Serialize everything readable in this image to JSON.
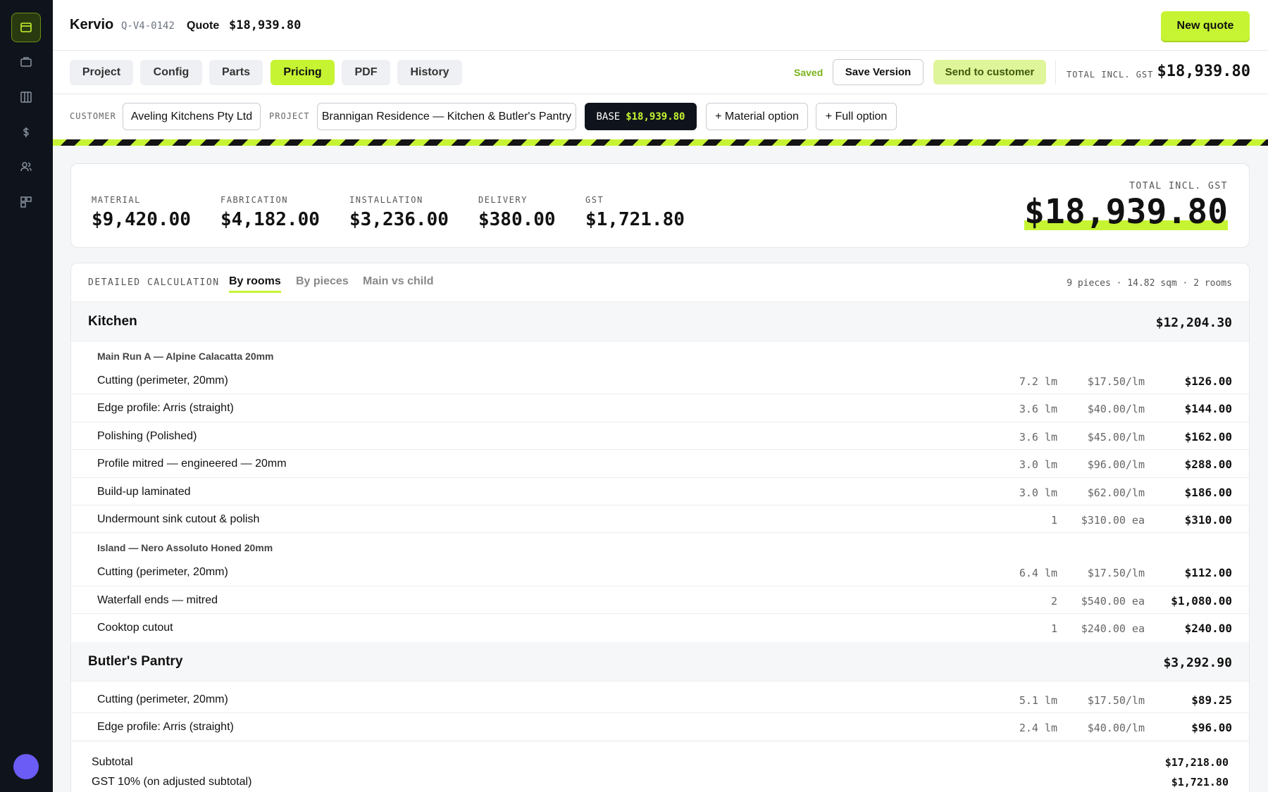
{
  "app": {
    "brand": "Kervio",
    "quote_id": "Q-V4-0142",
    "quote_label": "Quote",
    "quote_amount": "$18,939.80",
    "new_quote": "New quote"
  },
  "tabs": [
    "Project",
    "Config",
    "Parts",
    "Pricing",
    "PDF",
    "History"
  ],
  "active_tab": "Pricing",
  "status": {
    "saved": "Saved",
    "save_version": "Save Version",
    "send_to_customer": "Send to customer",
    "total_label": "TOTAL INCL. GST",
    "total_value": "$18,939.80"
  },
  "filters": {
    "customer_label": "CUSTOMER",
    "customer": "Aveling Kitchens Pty Ltd",
    "project_label": "PROJECT",
    "project": "Brannigan Residence — Kitchen & Butler's Pantry",
    "base_label": "BASE",
    "base_amount": "$18,939.80",
    "material_option": "+ Material option",
    "full_option": "+ Full option"
  },
  "summary": {
    "metrics": [
      {
        "label": "MATERIAL",
        "value": "$9,420.00"
      },
      {
        "label": "FABRICATION",
        "value": "$4,182.00"
      },
      {
        "label": "INSTALLATION",
        "value": "$3,236.00"
      },
      {
        "label": "DELIVERY",
        "value": "$380.00"
      },
      {
        "label": "GST",
        "value": "$1,721.80"
      }
    ],
    "total_label": "TOTAL INCL. GST",
    "total_value": "$18,939.80"
  },
  "detail": {
    "label": "DETAILED CALCULATION",
    "views": [
      "By rooms",
      "By pieces",
      "Main vs child"
    ],
    "active_view": "By rooms",
    "stats": "9 pieces · 14.82 sqm · 2 rooms",
    "rooms": [
      {
        "name": "Kitchen",
        "total": "$12,204.30",
        "groups": [
          {
            "name": "Main Run A — Alpine Calacatta 20mm",
            "items": [
              {
                "name": "Cutting (perimeter, 20mm)",
                "qty": "7.2 lm",
                "rate": "$17.50/lm",
                "amount": "$126.00"
              },
              {
                "name": "Edge profile: Arris (straight)",
                "qty": "3.6 lm",
                "rate": "$40.00/lm",
                "amount": "$144.00"
              },
              {
                "name": "Polishing (Polished)",
                "qty": "3.6 lm",
                "rate": "$45.00/lm",
                "amount": "$162.00"
              },
              {
                "name": "Profile mitred — engineered — 20mm",
                "qty": "3.0 lm",
                "rate": "$96.00/lm",
                "amount": "$288.00"
              },
              {
                "name": "Build-up laminated",
                "qty": "3.0 lm",
                "rate": "$62.00/lm",
                "amount": "$186.00"
              },
              {
                "name": "Undermount sink cutout & polish",
                "qty": "1",
                "rate": "$310.00 ea",
                "amount": "$310.00"
              }
            ]
          },
          {
            "name": "Island — Nero Assoluto Honed 20mm",
            "items": [
              {
                "name": "Cutting (perimeter, 20mm)",
                "qty": "6.4 lm",
                "rate": "$17.50/lm",
                "amount": "$112.00"
              },
              {
                "name": "Waterfall ends — mitred",
                "qty": "2",
                "rate": "$540.00 ea",
                "amount": "$1,080.00"
              },
              {
                "name": "Cooktop cutout",
                "qty": "1",
                "rate": "$240.00 ea",
                "amount": "$240.00"
              }
            ]
          }
        ]
      },
      {
        "name": "Butler's Pantry",
        "total": "$3,292.90",
        "groups": [
          {
            "name": "",
            "items": [
              {
                "name": "Cutting (perimeter, 20mm)",
                "qty": "5.1 lm",
                "rate": "$17.50/lm",
                "amount": "$89.25"
              },
              {
                "name": "Edge profile: Arris (straight)",
                "qty": "2.4 lm",
                "rate": "$40.00/lm",
                "amount": "$96.00"
              }
            ]
          }
        ]
      }
    ],
    "totals": [
      {
        "label": "Subtotal",
        "value": "$17,218.00"
      },
      {
        "label": "GST 10% (on adjusted subtotal)",
        "value": "$1,721.80"
      }
    ]
  },
  "colors": {
    "accent": "#c6f432",
    "sidebar": "#0f141c",
    "avatar": "#6b5cf6"
  },
  "sidebar_icons": [
    "quote-icon",
    "briefcase-icon",
    "columns-icon",
    "dollar-icon",
    "users-icon",
    "widgets-icon"
  ]
}
